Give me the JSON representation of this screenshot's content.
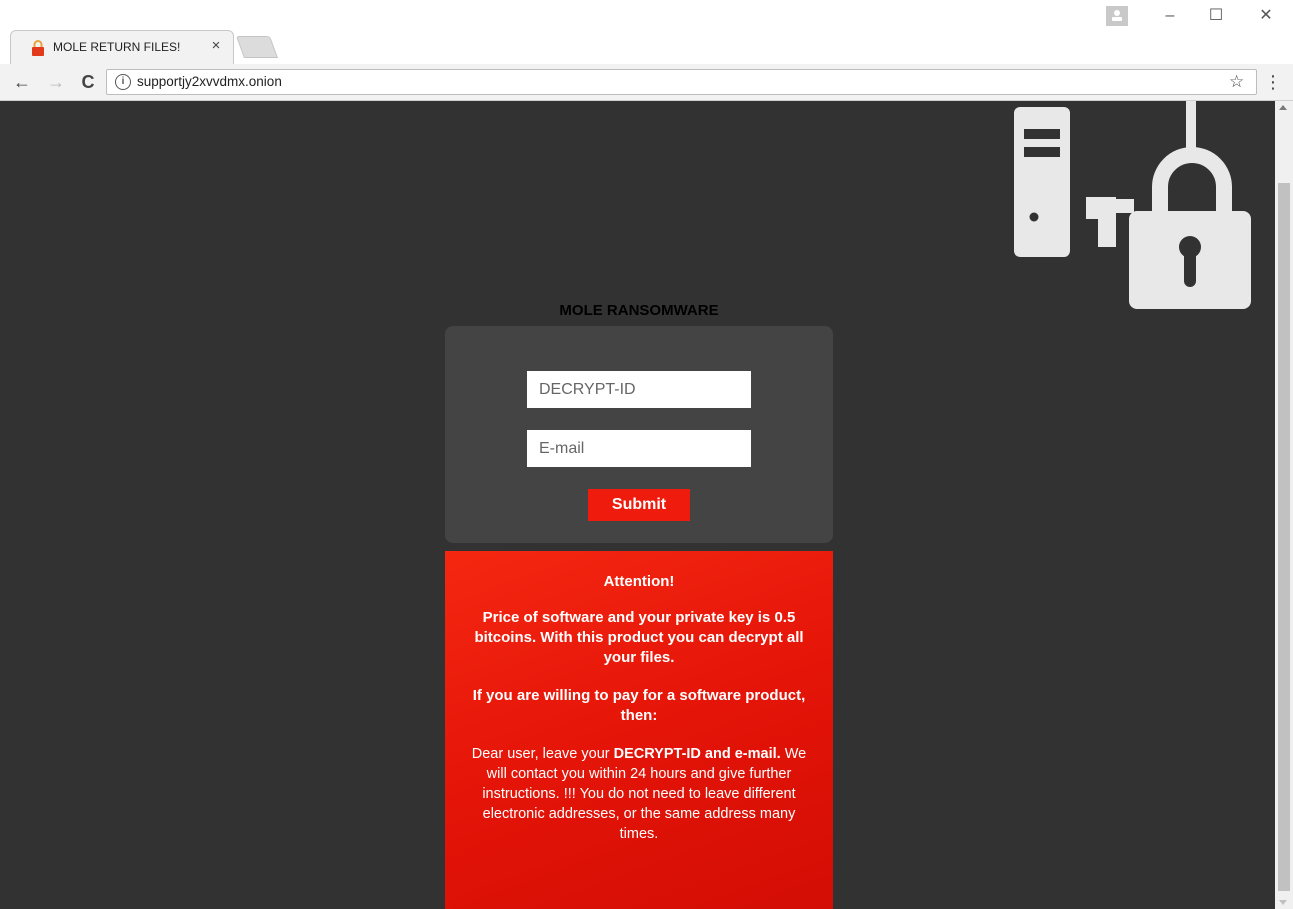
{
  "browser": {
    "tab": {
      "title": "MOLE RETURN FILES!",
      "close_label": "×"
    },
    "window_controls": {
      "minimize": "–",
      "maximize": "☐",
      "close": "✕"
    },
    "nav": {
      "back": "←",
      "forward": "→",
      "reload": "C"
    },
    "address": {
      "info": "i",
      "url": "supportjy2xvvdmx.onion",
      "star": "☆",
      "menu": "⋮"
    }
  },
  "page": {
    "title": "MOLE RANSOMWARE",
    "form": {
      "decrypt_id_placeholder": "DECRYPT-ID",
      "email_placeholder": "E-mail",
      "submit_label": "Submit"
    },
    "notice": {
      "heading": "Attention!",
      "price_text": "Price of software and your private key is 0.5 bitcoins. With this product you can decrypt all your files.",
      "willing_text": "If you are willing to pay for a software product, then:",
      "body_intro": "Dear user, leave your ",
      "body_bold": "DECRYPT-ID and e-mail.",
      "body_rest": " We will contact you within 24 hours and give further instructions. !!! You do not need to leave different electronic addresses, or the same address many times."
    }
  },
  "colors": {
    "page_background": "#323232",
    "form_box": "#444444",
    "submit": "#ef1c0e",
    "notice": "#e41408"
  },
  "icons": {
    "tab_favicon": "lock-icon",
    "hero": "server-padlock-icon"
  }
}
